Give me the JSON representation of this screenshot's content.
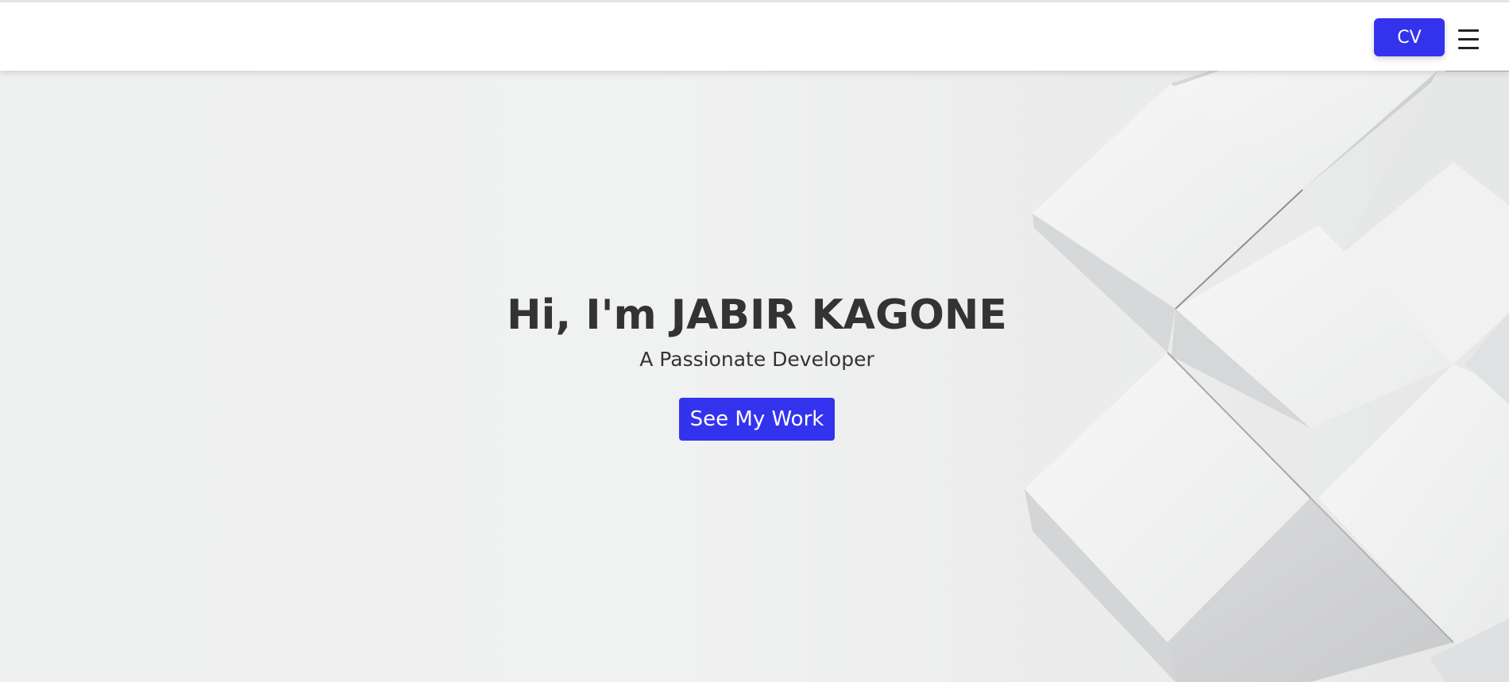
{
  "navbar": {
    "cv_label": "CV",
    "menu_icon": "hamburger-menu-icon"
  },
  "hero": {
    "title": "Hi, I'm JABIR KAGONE",
    "subtitle": "A Passionate Developer",
    "cta_label": "See My Work",
    "background": "white-cubes-pattern"
  },
  "colors": {
    "accent": "#3333ee",
    "text": "#333333",
    "background": "#eff0f0",
    "navbar": "#ffffff"
  }
}
